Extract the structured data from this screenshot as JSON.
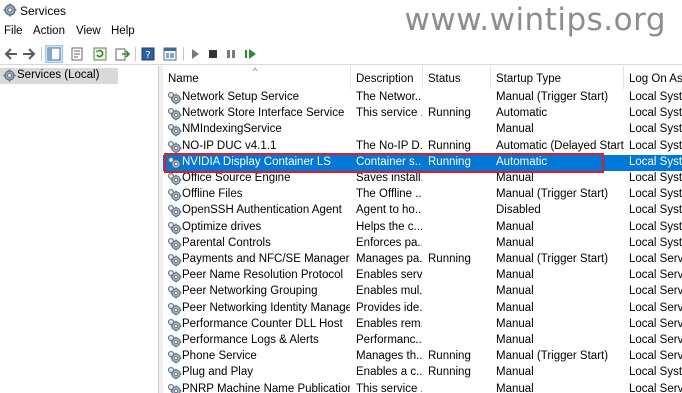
{
  "window": {
    "title": "Services"
  },
  "watermark": "www.wintips.org",
  "menu": [
    "File",
    "Action",
    "View",
    "Help"
  ],
  "toolbar": {
    "icons": [
      "back-arrow-icon",
      "forward-arrow-icon",
      "console-tree-icon",
      "properties-icon",
      "refresh-icon",
      "export-list-icon",
      "help-icon",
      "mmc-icon",
      "play-icon",
      "stop-icon",
      "pause-icon",
      "restart-icon"
    ]
  },
  "tree": {
    "label": "Services (Local)"
  },
  "columns": {
    "name": "Name",
    "description": "Description",
    "status": "Status",
    "startup": "Startup Type",
    "logon": "Log On As",
    "sort_indicator": "^"
  },
  "services": [
    {
      "name": "Network Setup Service",
      "description": "The Networ...",
      "status": "",
      "startup": "Manual (Trigger Start)",
      "logon": "Local Syster"
    },
    {
      "name": "Network Store Interface Service",
      "description": "This service ...",
      "status": "Running",
      "startup": "Automatic",
      "logon": "Local Syster"
    },
    {
      "name": "NMIndexingService",
      "description": "",
      "status": "",
      "startup": "Manual",
      "logon": "Local Syster"
    },
    {
      "name": "NO-IP DUC v4.1.1",
      "description": "The No-IP D...",
      "status": "Running",
      "startup": "Automatic (Delayed Start)",
      "logon": "Local Syster"
    },
    {
      "name": "NVIDIA Display Container LS",
      "description": "Container s...",
      "status": "Running",
      "startup": "Automatic",
      "logon": "Local Syster",
      "selected": true
    },
    {
      "name": "Office  Source Engine",
      "description": "Saves install...",
      "status": "",
      "startup": "Manual",
      "logon": "Local Syster"
    },
    {
      "name": "Offline Files",
      "description": "The Offline ...",
      "status": "",
      "startup": "Manual (Trigger Start)",
      "logon": "Local Syster"
    },
    {
      "name": "OpenSSH Authentication Agent",
      "description": "Agent to ho...",
      "status": "",
      "startup": "Disabled",
      "logon": "Local Syster"
    },
    {
      "name": "Optimize drives",
      "description": "Helps the c...",
      "status": "",
      "startup": "Manual",
      "logon": "Local Syster"
    },
    {
      "name": "Parental Controls",
      "description": "Enforces pa...",
      "status": "",
      "startup": "Manual",
      "logon": "Local Syster"
    },
    {
      "name": "Payments and NFC/SE Manager",
      "description": "Manages pa...",
      "status": "Running",
      "startup": "Manual (Trigger Start)",
      "logon": "Local Servic"
    },
    {
      "name": "Peer Name Resolution Protocol",
      "description": "Enables serv...",
      "status": "",
      "startup": "Manual",
      "logon": "Local Servic"
    },
    {
      "name": "Peer Networking Grouping",
      "description": "Enables mul...",
      "status": "",
      "startup": "Manual",
      "logon": "Local Servic"
    },
    {
      "name": "Peer Networking Identity Manager",
      "description": "Provides ide...",
      "status": "",
      "startup": "Manual",
      "logon": "Local Servic"
    },
    {
      "name": "Performance Counter DLL Host",
      "description": "Enables rem...",
      "status": "",
      "startup": "Manual",
      "logon": "Local Servic"
    },
    {
      "name": "Performance Logs & Alerts",
      "description": "Performanc...",
      "status": "",
      "startup": "Manual",
      "logon": "Local Servic"
    },
    {
      "name": "Phone Service",
      "description": "Manages th...",
      "status": "Running",
      "startup": "Manual (Trigger Start)",
      "logon": "Local Servic"
    },
    {
      "name": "Plug and Play",
      "description": "Enables a c...",
      "status": "Running",
      "startup": "Manual",
      "logon": "Local Syster"
    },
    {
      "name": "PNRP Machine Name Publication S...",
      "description": "This service ...",
      "status": "",
      "startup": "Manual",
      "logon": "Local Servic"
    }
  ],
  "colors": {
    "selection": "#0078d7",
    "highlight_box": "#e11c24"
  }
}
